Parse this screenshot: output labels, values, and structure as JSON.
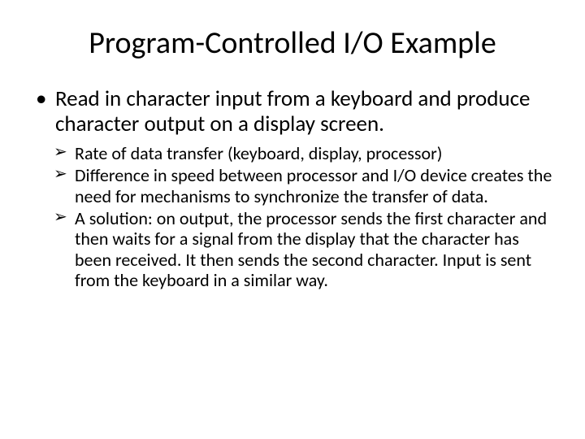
{
  "title": "Program-Controlled I/O Example",
  "bullets": {
    "main": "Read in character input from a keyboard and produce character output on a display screen.",
    "sub": [
      "Rate of data transfer (keyboard, display, processor)",
      "Difference in speed between processor and I/O device creates the need for mechanisms to synchronize the transfer of data.",
      "A solution: on output, the processor sends the first character and then waits for a signal from the display that the character has been received. It then sends the second character. Input is sent from the keyboard in a similar way."
    ]
  }
}
